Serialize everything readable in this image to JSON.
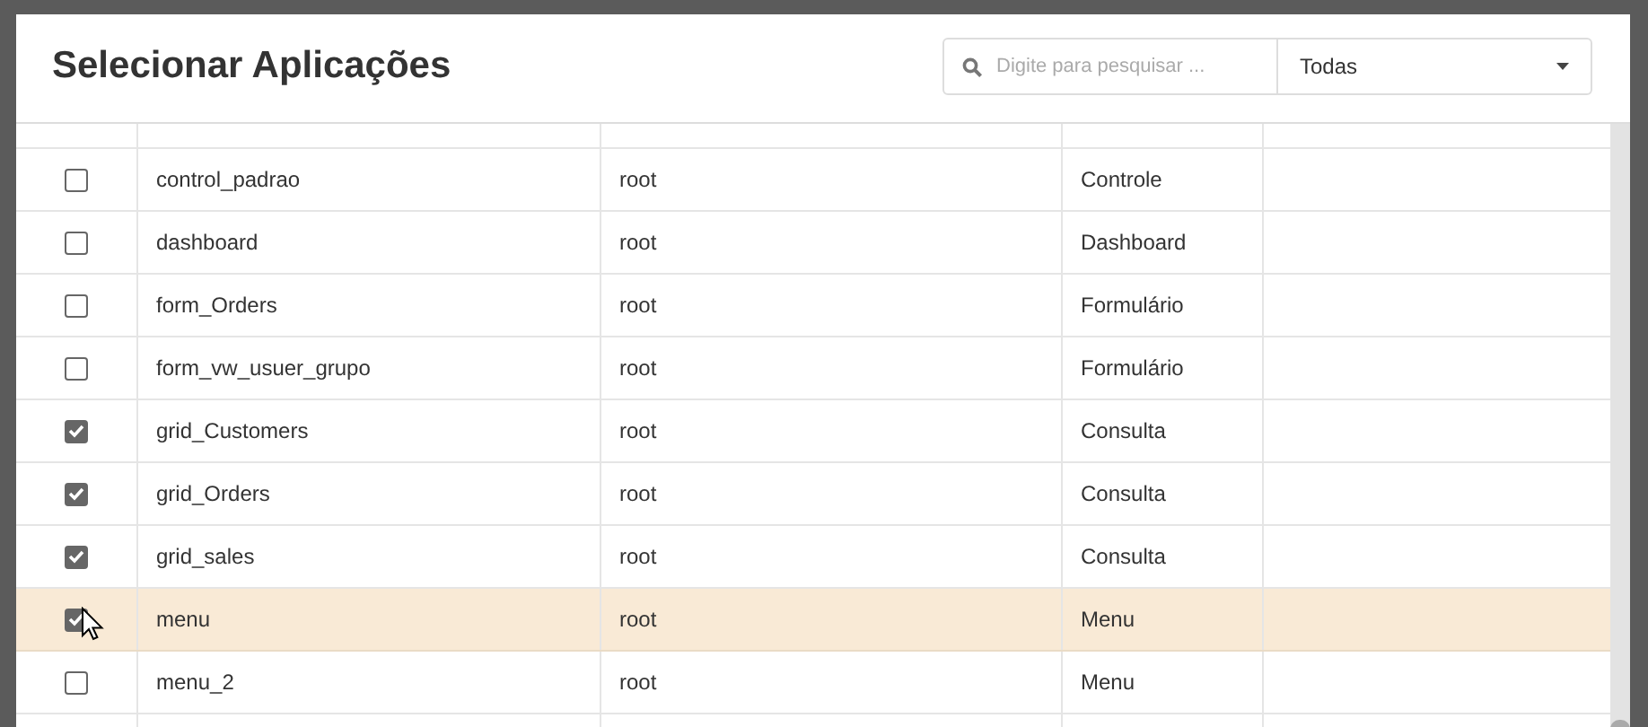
{
  "dialog": {
    "title": "Selecionar Aplicações"
  },
  "search": {
    "placeholder": "Digite para pesquisar ..."
  },
  "filter": {
    "value": "Todas"
  },
  "table": {
    "rows": [
      {
        "checked": false,
        "highlighted": false,
        "name": "control_padrao",
        "owner": "root",
        "type": "Controle"
      },
      {
        "checked": false,
        "highlighted": false,
        "name": "dashboard",
        "owner": "root",
        "type": "Dashboard"
      },
      {
        "checked": false,
        "highlighted": false,
        "name": "form_Orders",
        "owner": "root",
        "type": "Formulário"
      },
      {
        "checked": false,
        "highlighted": false,
        "name": "form_vw_usuer_grupo",
        "owner": "root",
        "type": "Formulário"
      },
      {
        "checked": true,
        "highlighted": false,
        "name": "grid_Customers",
        "owner": "root",
        "type": "Consulta"
      },
      {
        "checked": true,
        "highlighted": false,
        "name": "grid_Orders",
        "owner": "root",
        "type": "Consulta"
      },
      {
        "checked": true,
        "highlighted": false,
        "name": "grid_sales",
        "owner": "root",
        "type": "Consulta"
      },
      {
        "checked": true,
        "highlighted": true,
        "name": "menu",
        "owner": "root",
        "type": "Menu"
      },
      {
        "checked": false,
        "highlighted": false,
        "name": "menu_2",
        "owner": "root",
        "type": "Menu"
      }
    ]
  }
}
